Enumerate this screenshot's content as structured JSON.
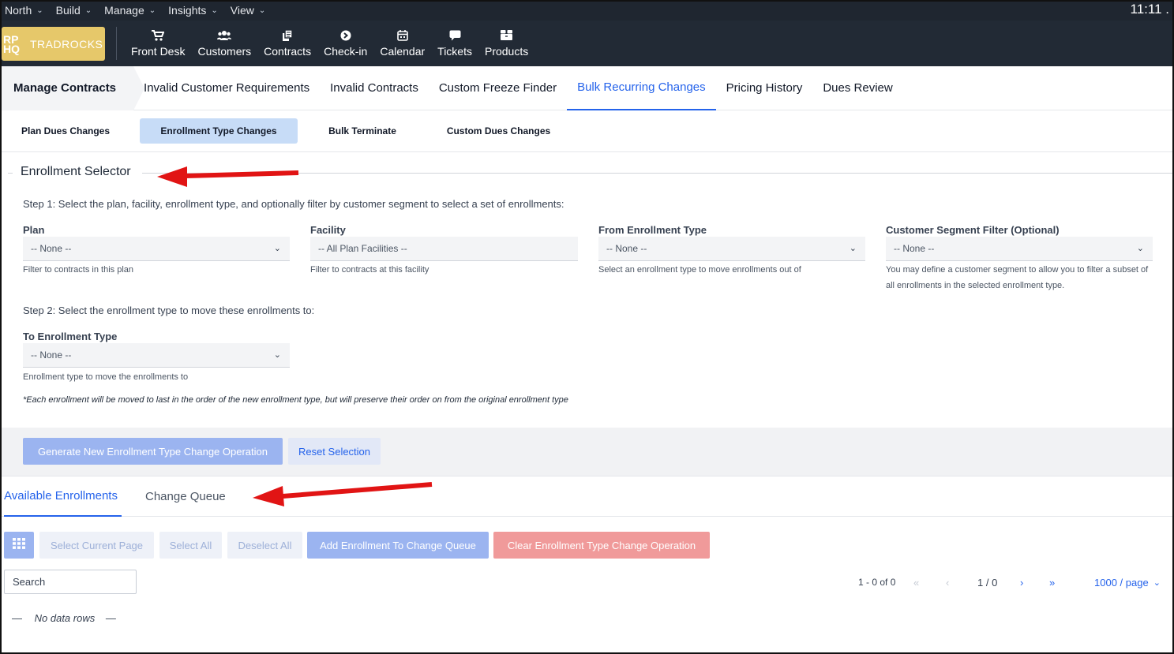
{
  "menubar": {
    "items": [
      "North",
      "Build",
      "Manage",
      "Insights",
      "View"
    ],
    "clock": "11:11 ."
  },
  "brand": {
    "mark": "RP HQ",
    "name": "TRADROCKS"
  },
  "nav": [
    {
      "label": "Front Desk",
      "icon": "cart-icon"
    },
    {
      "label": "Customers",
      "icon": "users-icon"
    },
    {
      "label": "Contracts",
      "icon": "documents-icon"
    },
    {
      "label": "Check-in",
      "icon": "arrow-circle-icon"
    },
    {
      "label": "Calendar",
      "icon": "calendar-icon"
    },
    {
      "label": "Tickets",
      "icon": "chat-bubble-icon"
    },
    {
      "label": "Products",
      "icon": "boxes-icon"
    }
  ],
  "page": {
    "breadcrumb": "Manage Contracts",
    "tabs": [
      "Invalid Customer Requirements",
      "Invalid Contracts",
      "Custom Freeze Finder",
      "Bulk Recurring Changes",
      "Pricing History",
      "Dues Review"
    ],
    "active_tab": "Bulk Recurring Changes",
    "subtabs": [
      "Plan Dues Changes",
      "Enrollment Type Changes",
      "Bulk Terminate",
      "Custom Dues Changes"
    ],
    "active_subtab": "Enrollment Type Changes"
  },
  "selector": {
    "title": "Enrollment Selector",
    "step1": "Step 1: Select the plan, facility, enrollment type, and optionally filter by customer segment to select a set of enrollments:",
    "plan": {
      "label": "Plan",
      "value": "-- None --",
      "hint": "Filter to contracts in this plan"
    },
    "facility": {
      "label": "Facility",
      "value": "-- All Plan Facilities --",
      "hint": "Filter to contracts at this facility"
    },
    "from_type": {
      "label": "From Enrollment Type",
      "value": "-- None --",
      "hint": "Select an enrollment type to move enrollments out of"
    },
    "segment": {
      "label": "Customer Segment Filter (Optional)",
      "value": "-- None --",
      "hint": "You may define a customer segment to allow you to filter a subset of all enrollments in the selected enrollment type."
    },
    "step2": "Step 2: Select the enrollment type to move these enrollments to:",
    "to_type": {
      "label": "To Enrollment Type",
      "value": "-- None --",
      "hint": "Enrollment type to move the enrollments to"
    },
    "note": "*Each enrollment will be moved to last in the order of the new enrollment type, but will preserve their order on from the original enrollment type"
  },
  "actions": {
    "generate": "Generate New Enrollment Type Change Operation",
    "reset": "Reset Selection"
  },
  "lower_tabs": [
    "Available Enrollments",
    "Change Queue"
  ],
  "active_lower_tab": "Available Enrollments",
  "toolbar": {
    "select_page": "Select Current Page",
    "select_all": "Select All",
    "deselect_all": "Deselect All",
    "add_queue": "Add Enrollment To Change Queue",
    "clear_op": "Clear Enrollment Type Change Operation"
  },
  "search": {
    "placeholder": "Search"
  },
  "pagination": {
    "range": "1 - 0 of 0",
    "page": "1 / 0",
    "per_page": "1000 / page"
  },
  "empty": {
    "dash": "—",
    "text": "No data rows"
  },
  "colors": {
    "accent": "#2563eb",
    "annotation_arrow": "#e11414",
    "nav_bg": "#222a35",
    "brand": "#e6c86a"
  }
}
